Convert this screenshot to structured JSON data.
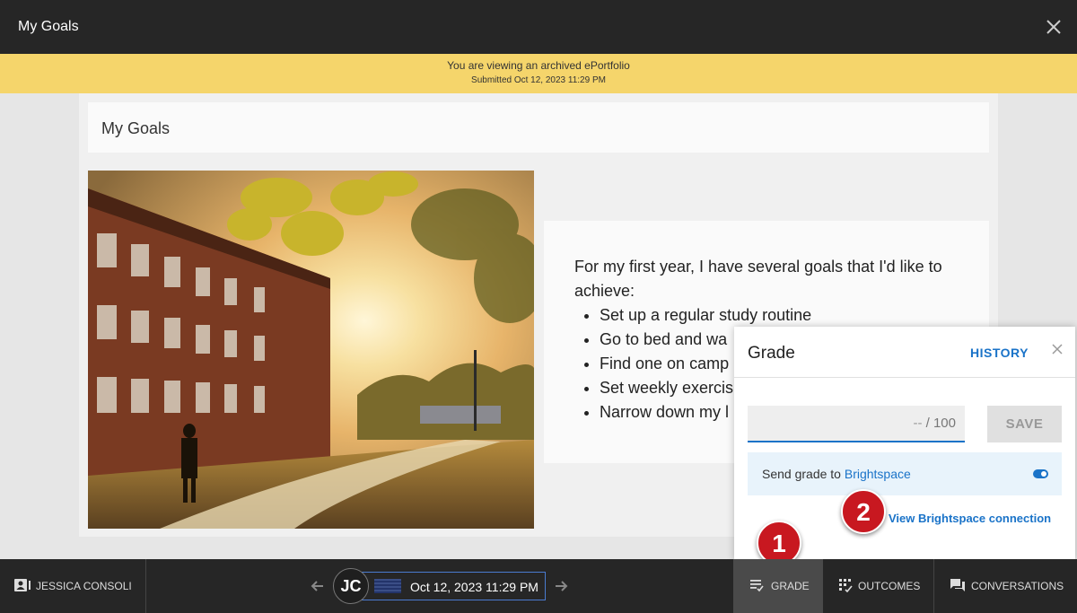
{
  "header": {
    "title": "My Goals"
  },
  "banner": {
    "line1": "You are viewing an archived ePortfolio",
    "line2": "Submitted Oct 12, 2023 11:29 PM"
  },
  "page": {
    "title": "My Goals",
    "intro": "For my first year, I have several goals that I'd like to achieve:",
    "goals": [
      "Set up a regular study routine",
      "Go to bed and wa",
      "Find one on camp",
      "Set weekly exercis",
      "Narrow down my l"
    ]
  },
  "grade_panel": {
    "title": "Grade",
    "history_label": "HISTORY",
    "score_value": "--",
    "score_max": "/ 100",
    "save_label": "SAVE",
    "send_text": "Send grade to ",
    "send_link": "Brightspace",
    "send_enabled": true,
    "connection_link": "View Brightspace connection"
  },
  "badges": {
    "one": "1",
    "two": "2"
  },
  "bottom_bar": {
    "student_name": "JESSICA CONSOLI",
    "avatar_initials": "JC",
    "submission_date": "Oct 12, 2023 11:29 PM",
    "tabs": {
      "grade": "GRADE",
      "outcomes": "OUTCOMES",
      "conversations": "CONVERSATIONS"
    }
  },
  "colors": {
    "accent": "#1a73c8",
    "banner": "#f5d56b",
    "badge": "#c81820",
    "bar": "#262626"
  }
}
